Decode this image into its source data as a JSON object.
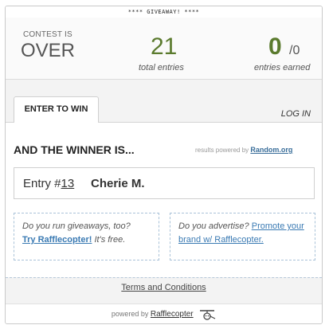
{
  "banner": "**** GIVEAWAY! ****",
  "stats": {
    "status_small": "CONTEST IS",
    "status_big": "OVER",
    "total_entries_value": "21",
    "total_entries_label": "total entries",
    "earned_value": "0",
    "earned_of": "/0",
    "earned_label": "entries earned"
  },
  "tabs": {
    "enter": "ENTER TO WIN",
    "login": "LOG IN"
  },
  "winner": {
    "heading": "AND THE WINNER IS...",
    "powered_prefix": "results powered by",
    "powered_link": "Random.org",
    "entry_prefix": "Entry #",
    "entry_number": "13",
    "name": "Cherie M."
  },
  "promos": {
    "left_question": "Do you run giveaways, too?",
    "left_cta": "Try Rafflecopter!",
    "left_tail": "It's free.",
    "right_question": "Do you advertise?",
    "right_cta": "Promote your brand w/ Rafflecopter."
  },
  "terms": "Terms and Conditions",
  "footer": {
    "prefix": "powered by",
    "brand": "Rafflecopter",
    "icon": "rafflecopter-logo-icon"
  },
  "colors": {
    "stat_green": "#5a7a2d",
    "link_blue": "#3a7ab3",
    "dashed_border": "#a9c2d8"
  }
}
